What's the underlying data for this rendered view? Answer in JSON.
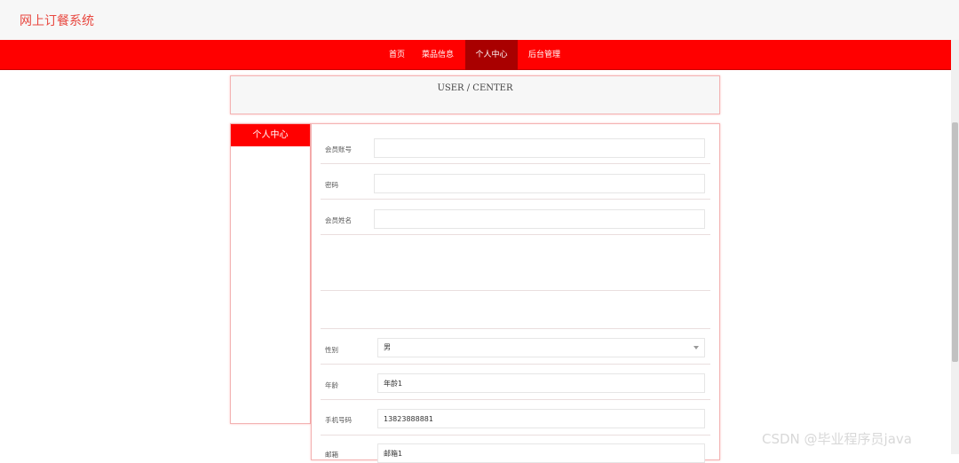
{
  "header": {
    "site_title": "网上订餐系统"
  },
  "nav": {
    "items": [
      {
        "label": "首页"
      },
      {
        "label": "菜品信息"
      },
      {
        "label": "个人中心"
      },
      {
        "label": "后台管理"
      }
    ],
    "active_index": 2
  },
  "banner": {
    "text": "USER / CENTER"
  },
  "sidebar": {
    "title": "个人中心"
  },
  "form": {
    "account_label": "会员账号",
    "account_value": "",
    "password_label": "密码",
    "password_value": "",
    "name_label": "会员姓名",
    "name_value": "",
    "gender_label": "性别",
    "gender_value": "男",
    "age_label": "年龄",
    "age_value": "年龄1",
    "phone_label": "手机号码",
    "phone_value": "13823888881",
    "email_label": "邮箱",
    "email_value": "邮箱1"
  },
  "watermark": {
    "text": "CSDN @毕业程序员java"
  },
  "colors": {
    "brand_red": "#ff0000",
    "active_nav": "#a90000",
    "title_red": "#e8473f"
  }
}
